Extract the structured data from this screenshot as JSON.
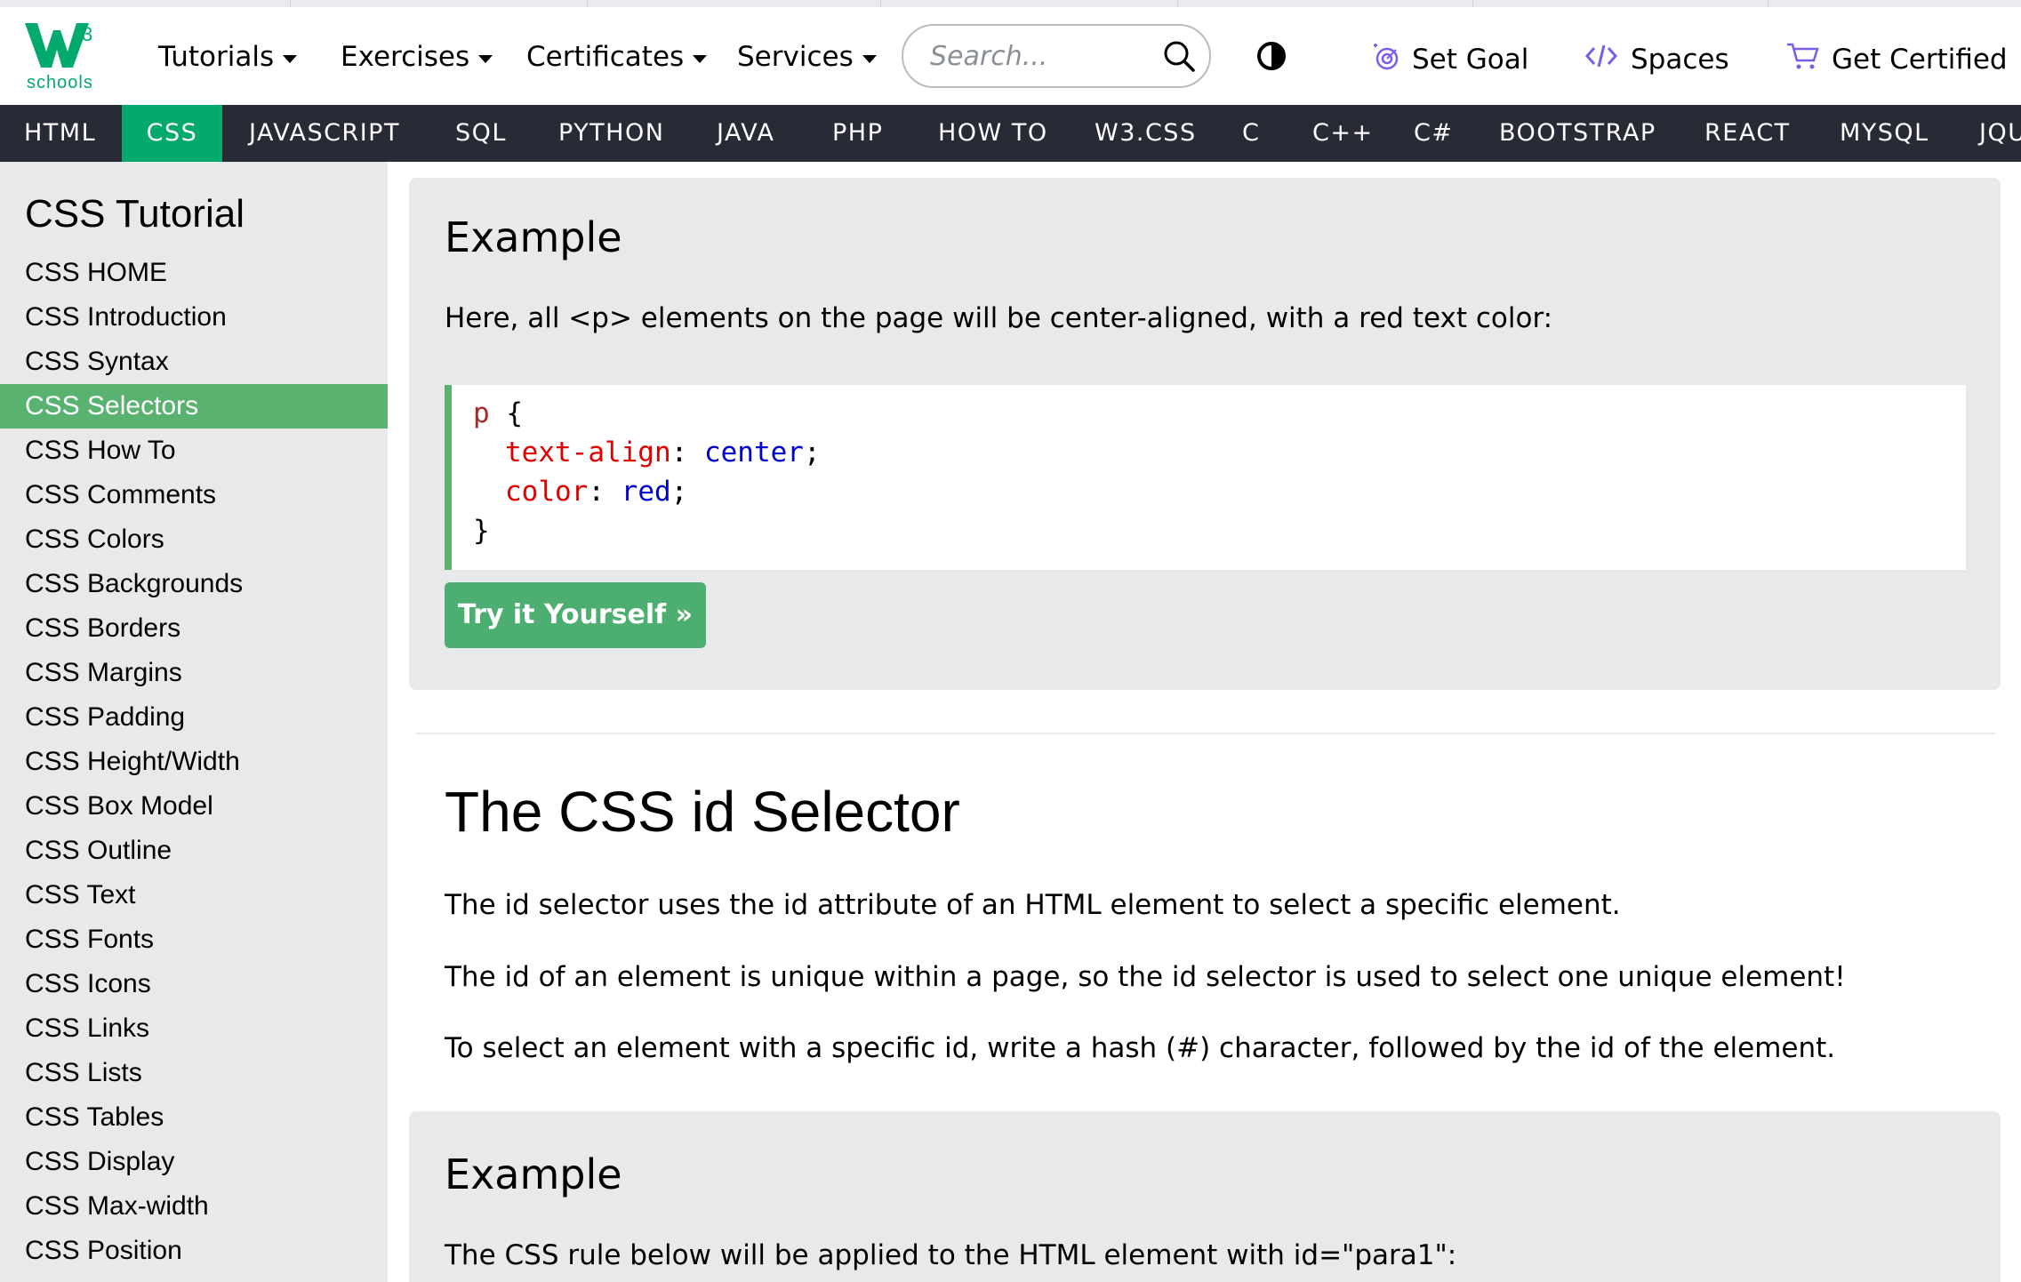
{
  "logo": {
    "sup": "3",
    "sub": "schools"
  },
  "header": {
    "menus": [
      {
        "label": "Tutorials"
      },
      {
        "label": "Exercises"
      },
      {
        "label": "Certificates"
      },
      {
        "label": "Services"
      }
    ],
    "search_placeholder": "Search...",
    "links": {
      "set_goal": "Set Goal",
      "spaces": "Spaces",
      "get_certified": "Get Certified"
    }
  },
  "nav": {
    "items": [
      "HTML",
      "CSS",
      "JAVASCRIPT",
      "SQL",
      "PYTHON",
      "JAVA",
      "PHP",
      "HOW TO",
      "W3.CSS",
      "C",
      "C++",
      "C#",
      "BOOTSTRAP",
      "REACT",
      "MYSQL",
      "JQU"
    ],
    "active": "CSS"
  },
  "sidebar": {
    "title": "CSS Tutorial",
    "items": [
      "CSS HOME",
      "CSS Introduction",
      "CSS Syntax",
      "CSS Selectors",
      "CSS How To",
      "CSS Comments",
      "CSS Colors",
      "CSS Backgrounds",
      "CSS Borders",
      "CSS Margins",
      "CSS Padding",
      "CSS Height/Width",
      "CSS Box Model",
      "CSS Outline",
      "CSS Text",
      "CSS Fonts",
      "CSS Icons",
      "CSS Links",
      "CSS Lists",
      "CSS Tables",
      "CSS Display",
      "CSS Max-width",
      "CSS Position"
    ],
    "active": "CSS Selectors"
  },
  "example1": {
    "title": "Example",
    "text": "Here, all <p> elements on the page will be center-aligned, with a red text color:",
    "code": {
      "selector": "p",
      "open": "{",
      "close": "}",
      "rules": [
        {
          "prop": "text-align",
          "value": "center"
        },
        {
          "prop": "color",
          "value": "red"
        }
      ]
    },
    "button": "Try it Yourself »"
  },
  "section": {
    "heading": "The CSS id Selector",
    "paragraphs": [
      "The id selector uses the id attribute of an HTML element to select a specific element.",
      "The id of an element is unique within a page, so the id selector is used to select one unique element!",
      "To select an element with a specific id, write a hash (#) character, followed by the id of the element."
    ]
  },
  "example2": {
    "title": "Example",
    "text": "The CSS rule below will be applied to the HTML element with id=\"para1\":"
  },
  "colors": {
    "green": "#04aa6d",
    "nav_bg": "#282a35",
    "panel_bg": "#e7e9eb",
    "accent_purple": "#7b5ce6"
  }
}
